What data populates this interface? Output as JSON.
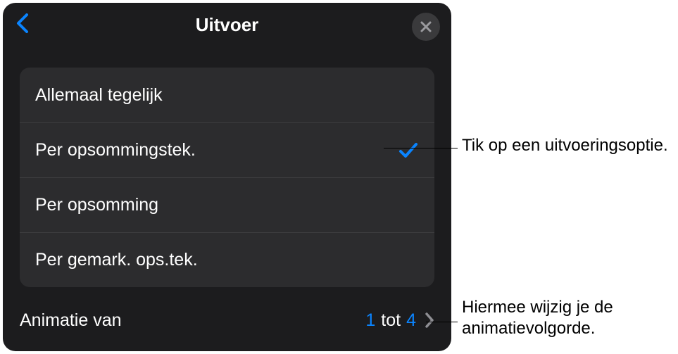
{
  "header": {
    "title": "Uitvoer"
  },
  "options": [
    {
      "label": "Allemaal tegelijk",
      "selected": false
    },
    {
      "label": "Per opsommingstek.",
      "selected": true
    },
    {
      "label": "Per opsomming",
      "selected": false
    },
    {
      "label": "Per gemark. ops.tek.",
      "selected": false
    }
  ],
  "footer": {
    "label": "Animatie van",
    "from": "1",
    "to_word": "tot",
    "to": "4"
  },
  "callouts": {
    "option": "Tik op een uitvoeringsoptie.",
    "order": "Hiermee wijzig je de animatievolgorde."
  },
  "colors": {
    "accent": "#0a84ff"
  }
}
